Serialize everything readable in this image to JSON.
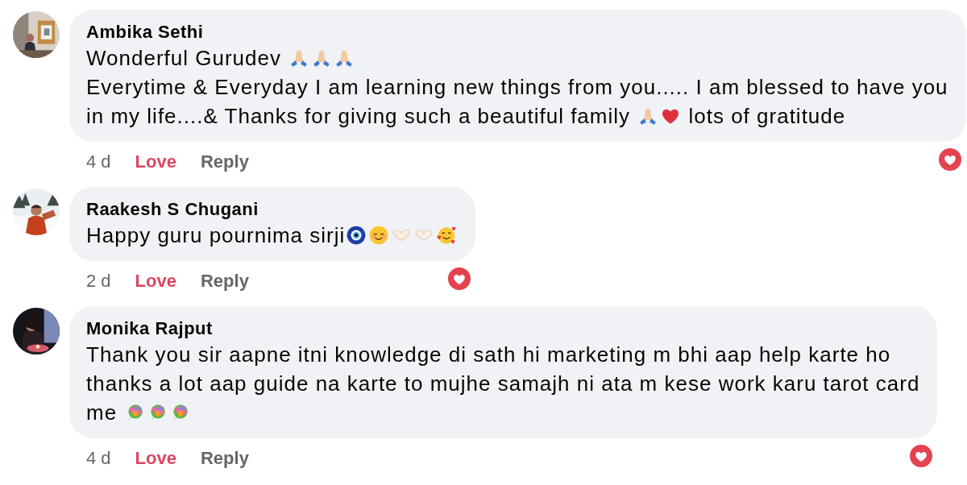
{
  "comments": [
    {
      "author": "Ambika Sethi",
      "avatar": {
        "kind": "picture"
      },
      "lines": [
        [
          {
            "kind": "text",
            "text": "Wonderful Gurudev "
          },
          {
            "kind": "pray"
          },
          {
            "kind": "pray"
          },
          {
            "kind": "pray"
          }
        ],
        [
          {
            "kind": "text",
            "text": "Everytime & Everyday I am learning new things from you..... I am blessed to have you"
          }
        ],
        [
          {
            "kind": "text",
            "text": "in my life....& Thanks for giving such a beautiful family "
          },
          {
            "kind": "pray"
          },
          {
            "kind": "heart"
          },
          {
            "kind": "text",
            "text": " lots of gratitude"
          }
        ]
      ],
      "time": "4 d",
      "react": {
        "label": "Love",
        "active": true
      },
      "reply": "Reply",
      "has_reactions": true
    },
    {
      "author": "Raakesh S Chugani",
      "avatar": {
        "kind": "picture"
      },
      "lines": [
        [
          {
            "kind": "text",
            "text": "Happy guru pournima sirji"
          },
          {
            "kind": "nazar"
          },
          {
            "kind": "relieved"
          },
          {
            "kind": "heart-hands"
          },
          {
            "kind": "heart-hands"
          },
          {
            "kind": "hearts-face"
          }
        ]
      ],
      "time": "2 d",
      "react": {
        "label": "Love",
        "active": true
      },
      "reply": "Reply",
      "has_reactions": true
    },
    {
      "author": "Monika Rajput",
      "avatar": {
        "kind": "picture"
      },
      "lines": [
        [
          {
            "kind": "text",
            "text": "Thank you sir aapne itni knowledge di sath hi marketing m bhi aap help karte ho"
          }
        ],
        [
          {
            "kind": "text",
            "text": "thanks a lot aap guide na karte to mujhe samajh ni ata m kese work karu tarot card"
          }
        ],
        [
          {
            "kind": "text",
            "text": "me "
          },
          {
            "kind": "bouquet"
          },
          {
            "kind": "bouquet"
          },
          {
            "kind": "bouquet"
          }
        ]
      ],
      "time": "4 d",
      "react": {
        "label": "Love",
        "active": true
      },
      "reply": "Reply",
      "has_reactions": true
    }
  ]
}
